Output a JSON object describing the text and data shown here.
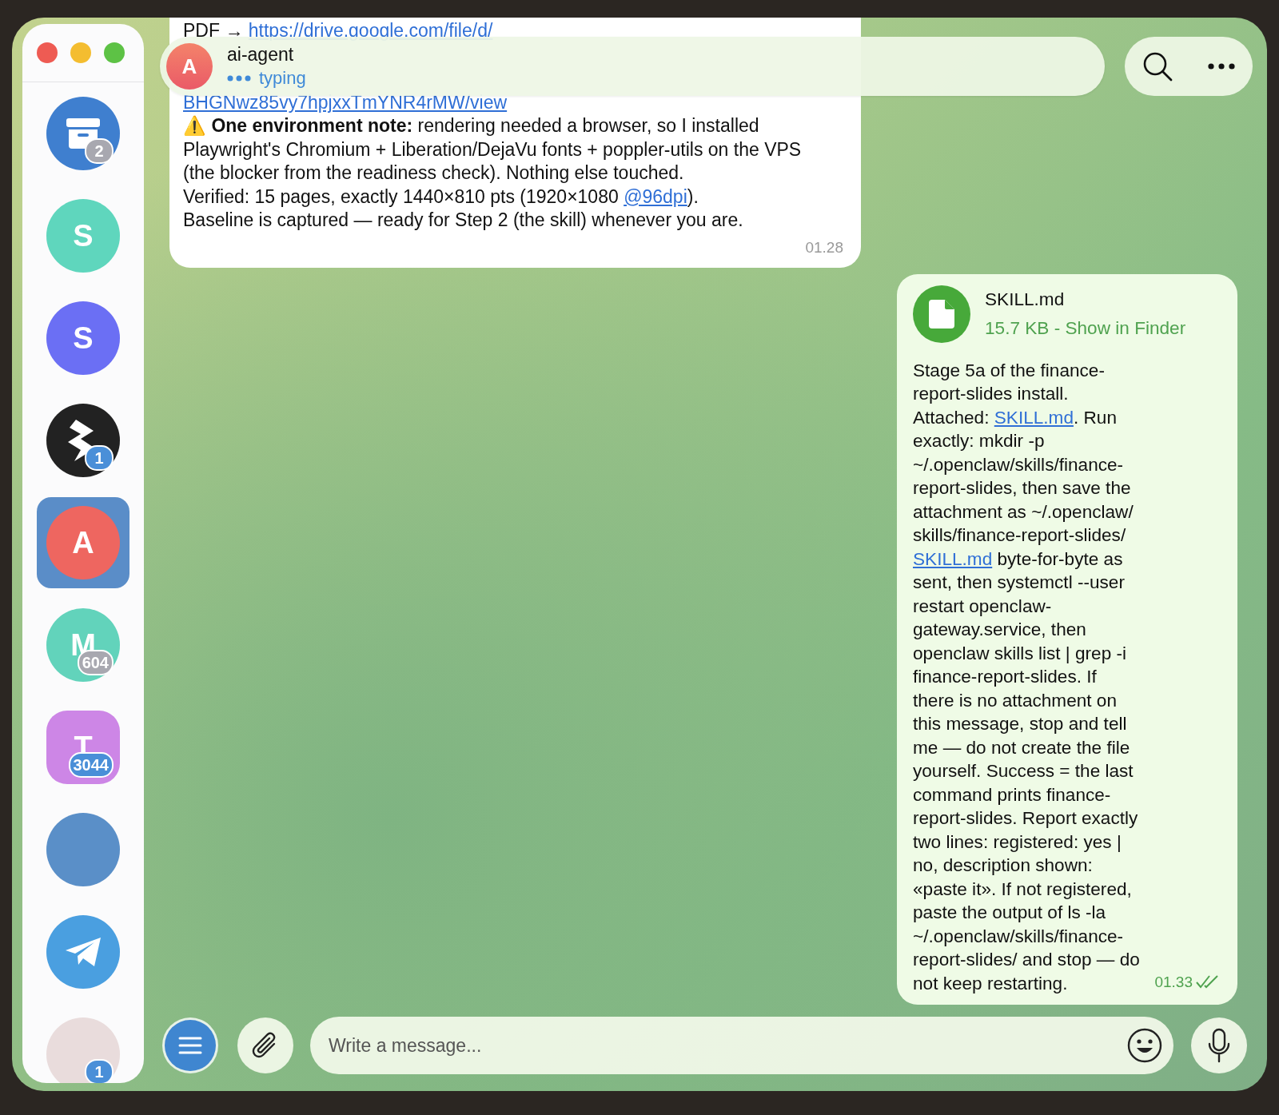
{
  "sidebar": {
    "chats": [
      {
        "kind": "archive",
        "color": "#3f7fcf",
        "selected": false,
        "badge": {
          "count": "2",
          "muted": true
        }
      },
      {
        "kind": "letter",
        "letter": "S",
        "color": "#5fd6bd",
        "selected": false
      },
      {
        "kind": "letter",
        "letter": "S",
        "color": "#6b6ff4",
        "selected": false
      },
      {
        "kind": "logo",
        "color": "#222222",
        "selected": false,
        "badge": {
          "count": "1",
          "muted": false
        }
      },
      {
        "kind": "letter",
        "letter": "A",
        "color": "#ee6660",
        "selected": true
      },
      {
        "kind": "letter",
        "letter": "M",
        "color": "#62d3bb",
        "selected": false,
        "badge": {
          "count": "604",
          "muted": true
        }
      },
      {
        "kind": "letter-square",
        "letter": "T",
        "color": "#cd86e6",
        "selected": false,
        "badge": {
          "count": "3044",
          "muted": false
        }
      },
      {
        "kind": "photo",
        "color": "#5a8fc8",
        "selected": false
      },
      {
        "kind": "plane",
        "color": "#4a9fe0",
        "selected": false
      },
      {
        "kind": "photo",
        "color": "#e9dcdc",
        "selected": false,
        "badge": {
          "count": "1",
          "muted": false
        }
      }
    ]
  },
  "header": {
    "avatar_letter": "A",
    "name": "ai-agent",
    "status": "typing"
  },
  "messages": [
    {
      "outgoing": false,
      "paragraphs": [
        [
          {
            "kind": "text",
            "text": "PDF → "
          },
          {
            "kind": "link",
            "text": "https://drive.google.com/file/d/"
          }
        ],
        [
          {
            "kind": "link",
            "text": "BHGNwz85vy7hpjxxTmYNR4rMW/view"
          },
          {
            "kind": "text",
            "text": "\n⚠️ **One environment note:** rendering needed a browser, so I installed Playwright's Chromium + Liberation/DejaVu fonts + poppler-utils on the VPS (the blocker from the readiness check). Nothing else touched.\nVerified: 15 pages, exactly 1440×810 pts (1920×1080 "
          },
          {
            "kind": "link",
            "text": "@96dpi"
          },
          {
            "kind": "text",
            "text": ").\nBaseline is captured — ready for Step 2 (the skill) whenever you are."
          }
        ]
      ],
      "time": "01.28",
      "read": false
    },
    {
      "outgoing": true,
      "file": {
        "name": "SKILL.md",
        "meta": "15.7 KB - Show in Finder"
      },
      "paragraphs": [
        [
          {
            "kind": "text",
            "text": "Stage 5a of the finance-report-slides install. Attached: "
          },
          {
            "kind": "link",
            "text": "SKILL.md"
          },
          {
            "kind": "text",
            "text": ". Run exactly: mkdir -p ~/.openclaw/skills/finance-report-slides, then save the attachment as ~/.openclaw/ skills/finance-report-slides/ "
          },
          {
            "kind": "link",
            "text": "SKILL.md"
          },
          {
            "kind": "text",
            "text": " byte-for-byte as sent, then systemctl --user restart openclaw-gateway.service, then openclaw skills list | grep -i finance-report-slides. If there is no attachment on this message, stop and tell me — do not create the file yourself. Success = the last command prints finance-report-slides. Report exactly two lines: registered: yes | no, description shown: «paste it». If not registered, paste the output of ls -la ~/.openclaw/skills/finance-report-slides/ and stop — do not keep restarting."
          }
        ]
      ],
      "time": "01.33",
      "read": true
    }
  ],
  "composer": {
    "placeholder": "Write a message..."
  }
}
